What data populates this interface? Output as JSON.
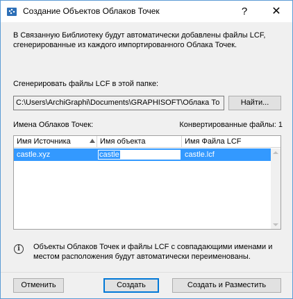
{
  "window": {
    "title": "Создание Объектов Облаков Точек",
    "help_glyph": "?",
    "close_glyph": "✕",
    "app_icon": "archicad-point-cloud-icon"
  },
  "intro_text": "В Связанную Библиотеку будут автоматически добавлены файлы LCF, сгенерированные из каждого импортированного Облака Точек.",
  "folder": {
    "label": "Сгенерировать файлы LCF в этой папке:",
    "path": "C:\\Users\\ArchiGraphi\\Documents\\GRAPHISOFT\\Облака То",
    "browse_label": "Найти..."
  },
  "names": {
    "label": "Имена Облаков Точек:",
    "converted_label": "Конвертированные файлы:",
    "converted_count": "1"
  },
  "table": {
    "columns": [
      "Имя Источника",
      "Имя объекта",
      "Имя Файла LCF"
    ],
    "sort_icon": "sort-ascending-icon",
    "rows": [
      {
        "source": "castle.xyz",
        "object": "castle",
        "lcf": "castle.lcf"
      }
    ]
  },
  "info": {
    "icon": "info-icon",
    "text": "Объекты Облаков Точек и файлы LCF с совпадающими именами и местом расположения будут автоматически переименованы."
  },
  "buttons": {
    "cancel": "Отменить",
    "create": "Создать",
    "create_place": "Создать и Разместить"
  },
  "colors": {
    "selection": "#3399ff",
    "default_button_border": "#0078d7",
    "window_border": "#5b9bd5"
  }
}
